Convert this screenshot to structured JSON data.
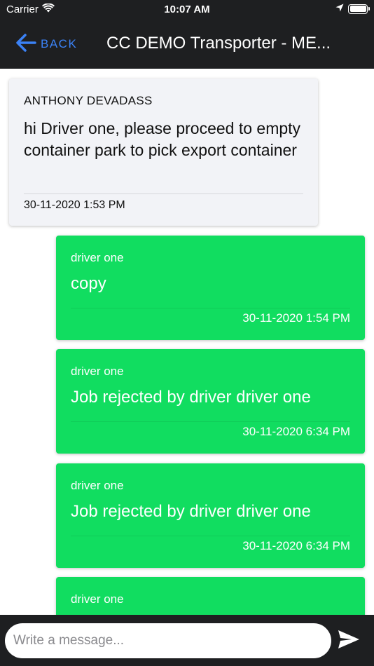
{
  "status_bar": {
    "carrier": "Carrier",
    "time": "10:07 AM"
  },
  "header": {
    "back_label": "BACK",
    "title": "CC DEMO Transporter - ME..."
  },
  "messages": [
    {
      "type": "incoming",
      "sender": "ANTHONY DEVADASS",
      "text": "hi Driver one, please proceed to empty container park to pick export container",
      "time": "30-11-2020 1:53 PM"
    },
    {
      "type": "outgoing",
      "sender": "driver one",
      "text": "copy",
      "time": "30-11-2020 1:54 PM"
    },
    {
      "type": "outgoing",
      "sender": "driver one",
      "text": "Job rejected by driver driver one",
      "time": "30-11-2020 6:34 PM"
    },
    {
      "type": "outgoing",
      "sender": "driver one",
      "text": "Job rejected by driver driver one",
      "time": "30-11-2020 6:34 PM"
    },
    {
      "type": "outgoing",
      "sender": "driver one",
      "text": "",
      "time": ""
    }
  ],
  "composer": {
    "placeholder": "Write a message..."
  },
  "icons": {
    "back": "arrow-left-icon",
    "send": "send-icon",
    "wifi": "wifi-icon",
    "location": "location-arrow-icon",
    "battery": "battery-icon"
  },
  "colors": {
    "header_bg": "#1e1f21",
    "accent": "#3b82f6",
    "outgoing_bubble": "#11dd60",
    "incoming_bubble": "#f2f3f7"
  }
}
